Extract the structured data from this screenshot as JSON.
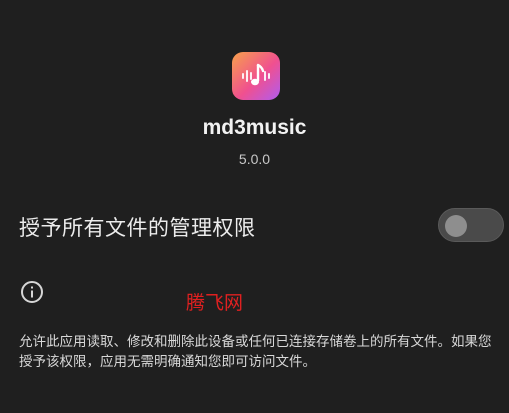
{
  "app": {
    "name": "md3music",
    "version": "5.0.0",
    "icon": "music-note-waveform-icon",
    "icon_gradient": [
      "#f7a14b",
      "#f0508f",
      "#b05cf0"
    ]
  },
  "setting": {
    "label": "授予所有文件的管理权限",
    "toggle_state": "off"
  },
  "info": {
    "icon": "info-icon",
    "watermark": "腾飞网",
    "description": "允许此应用读取、修改和删除此设备或任何已连接存储卷上的所有文件。如果您授予该权限，应用无需明确通知您即可访问文件。"
  },
  "colors": {
    "background": "#1f1f1f",
    "toggle_track": "#4a4a4a",
    "toggle_knob": "#8e8e8e",
    "watermark": "#e02020"
  }
}
